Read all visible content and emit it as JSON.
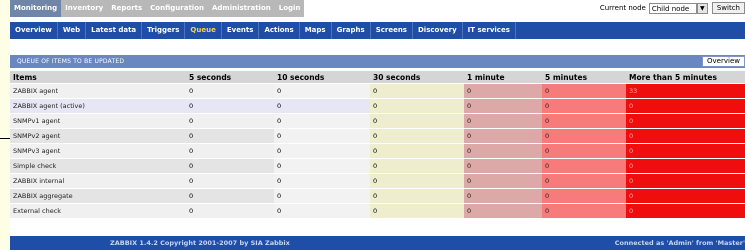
{
  "top_menu": [
    "Monitoring",
    "Inventory",
    "Reports",
    "Configuration",
    "Administration",
    "Login"
  ],
  "current_node": {
    "label": "Current node",
    "value": "Child node",
    "switch_label": "Switch"
  },
  "sub_menu": [
    {
      "label": "Overview",
      "active": false
    },
    {
      "label": "Web",
      "active": false
    },
    {
      "label": "Latest data",
      "active": false
    },
    {
      "label": "Triggers",
      "active": false
    },
    {
      "label": "Queue",
      "active": true
    },
    {
      "label": "Events",
      "active": false
    },
    {
      "label": "Actions",
      "active": false
    },
    {
      "label": "Maps",
      "active": false
    },
    {
      "label": "Graphs",
      "active": false
    },
    {
      "label": "Screens",
      "active": false
    },
    {
      "label": "Discovery",
      "active": false
    },
    {
      "label": "IT services",
      "active": false
    }
  ],
  "queue": {
    "title": "QUEUE OF ITEMS TO BE UPDATED",
    "view_select": "Overview",
    "columns": [
      "Items",
      "5 seconds",
      "10 seconds",
      "30 seconds",
      "1 minute",
      "5 minutes",
      "More than 5 minutes"
    ],
    "rows": [
      {
        "name": "ZABBIX agent",
        "values": [
          "0",
          "0",
          "0",
          "0",
          "0",
          "33"
        ]
      },
      {
        "name": "ZABBIX agent (active)",
        "values": [
          "0",
          "0",
          "0",
          "0",
          "0",
          "0"
        ]
      },
      {
        "name": "SNMPv1 agent",
        "values": [
          "0",
          "0",
          "0",
          "0",
          "0",
          "0"
        ]
      },
      {
        "name": "SNMPv2 agent",
        "values": [
          "0",
          "0",
          "0",
          "0",
          "0",
          "0"
        ]
      },
      {
        "name": "SNMPv3 agent",
        "values": [
          "0",
          "0",
          "0",
          "0",
          "0",
          "0"
        ]
      },
      {
        "name": "Simple check",
        "values": [
          "0",
          "0",
          "0",
          "0",
          "0",
          "0"
        ]
      },
      {
        "name": "ZABBIX internal",
        "values": [
          "0",
          "0",
          "0",
          "0",
          "0",
          "0"
        ]
      },
      {
        "name": "ZABBIX aggregate",
        "values": [
          "0",
          "0",
          "0",
          "0",
          "0",
          "0"
        ]
      },
      {
        "name": "External check",
        "values": [
          "0",
          "0",
          "0",
          "0",
          "0",
          "0"
        ]
      }
    ]
  },
  "footer": {
    "copyright": "ZABBIX 1.4.2 Copyright 2001-2007 by SIA Zabbix",
    "connected": "Connected as 'Admin' from 'Master'"
  },
  "colors": {
    "menu_blue": "#1f4ea8",
    "queue_header": "#6a87c2",
    "col_30s": "#eeeecf",
    "col_1m": "#dca8a8",
    "col_5m": "#f87b7b",
    "col_more": "#ef0d0d",
    "active_submenu": "#ffd23b"
  }
}
